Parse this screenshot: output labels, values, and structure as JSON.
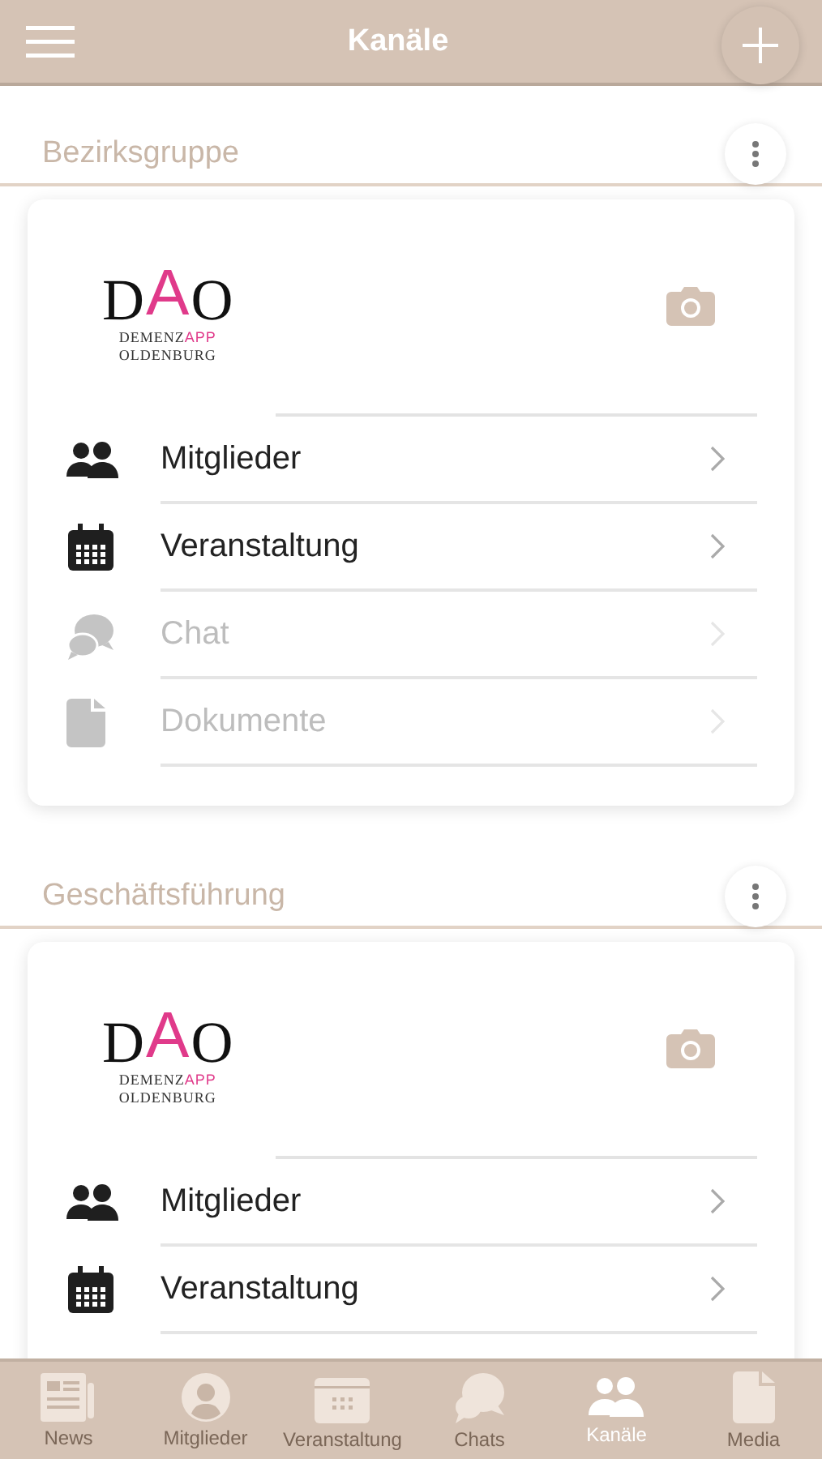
{
  "header": {
    "title": "Kanäle"
  },
  "channels": [
    {
      "name": "Bezirksgruppe",
      "logo": {
        "left": "D",
        "accent": "A",
        "right": "O",
        "word": "DEMENZ",
        "word_accent": "APP",
        "place": "OLDENBURG"
      },
      "items": [
        {
          "label": "Mitglieder",
          "disabled": false
        },
        {
          "label": "Veranstaltung",
          "disabled": false
        },
        {
          "label": "Chat",
          "disabled": true
        },
        {
          "label": "Dokumente",
          "disabled": true
        }
      ]
    },
    {
      "name": "Geschäftsführung",
      "logo": {
        "left": "D",
        "accent": "A",
        "right": "O",
        "word": "DEMENZ",
        "word_accent": "APP",
        "place": "OLDENBURG"
      },
      "items": [
        {
          "label": "Mitglieder",
          "disabled": false
        },
        {
          "label": "Veranstaltung",
          "disabled": false
        }
      ]
    }
  ],
  "tabbar": [
    {
      "label": "News",
      "selected": false
    },
    {
      "label": "Mitglieder",
      "selected": false
    },
    {
      "label": "Veranstaltung",
      "selected": false
    },
    {
      "label": "Chats",
      "selected": false
    },
    {
      "label": "Kanäle",
      "selected": true
    },
    {
      "label": "Media",
      "selected": false
    }
  ]
}
